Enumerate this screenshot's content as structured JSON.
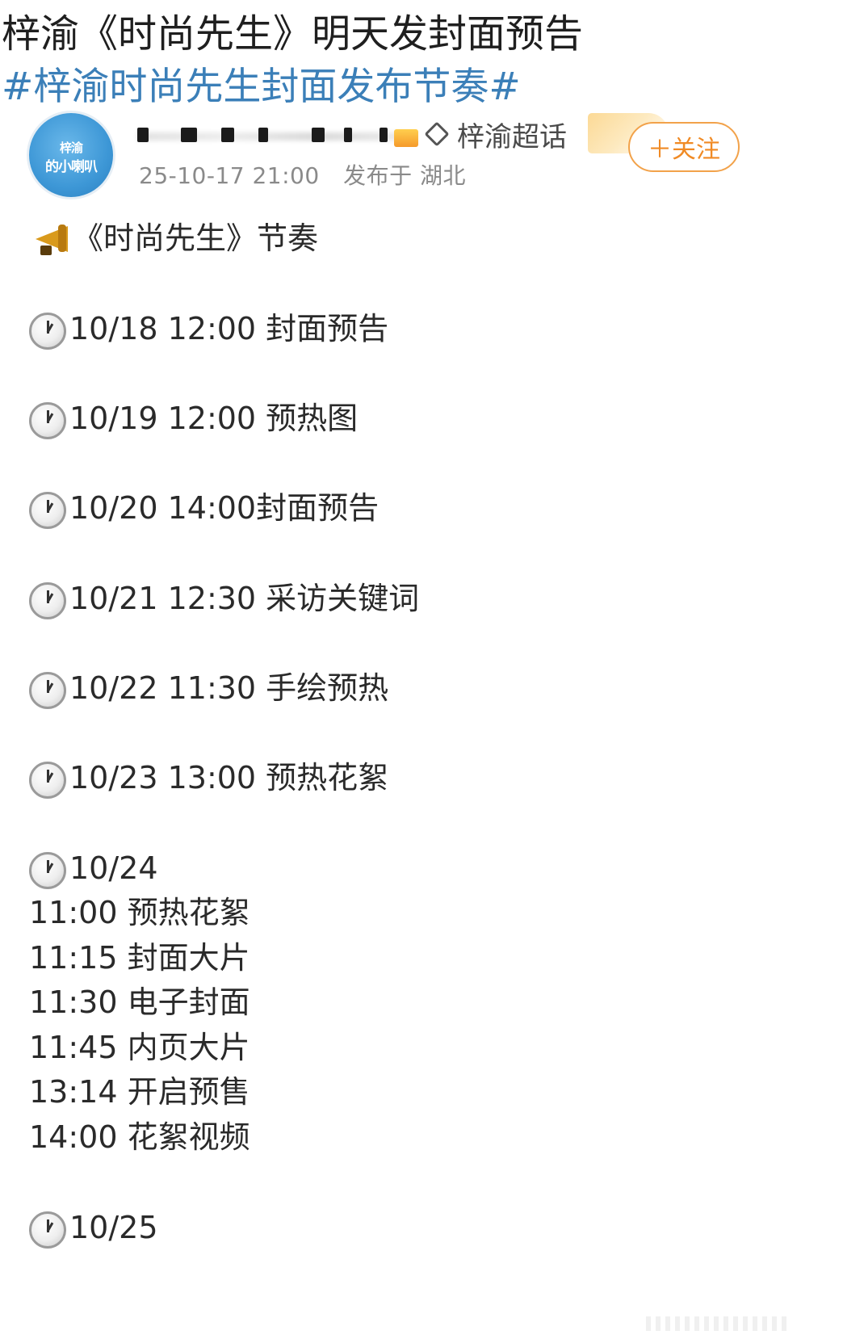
{
  "headline": "梓渝《时尚先生》明天发封面预告",
  "hashtag": "#梓渝时尚先生封面发布节奏#",
  "post": {
    "avatar_text_1": "梓渝",
    "avatar_text_2": "的小喇叭",
    "super_topic": "梓渝超话",
    "follow_label": "＋关注",
    "timestamp": "25-10-17 21:00",
    "location": "发布于 湖北"
  },
  "content": {
    "intro": "《时尚先生》节奏",
    "schedule": [
      "10/18 12:00 封面预告",
      "10/19 12:00 预热图",
      "10/20 14:00封面预告",
      "10/21 12:30 采访关键词",
      "10/22 11:30 手绘预热",
      "10/23 13:00 预热花絮"
    ],
    "day_1024": {
      "date": "10/24",
      "items": [
        "11:00 预热花絮",
        "11:15 封面大片",
        "11:30 电子封面",
        "11:45 内页大片",
        "13:14  开启预售",
        "14:00  花絮视频"
      ]
    },
    "day_1025": {
      "date": "10/25"
    }
  },
  "icons": {
    "intro": "megaphone-icon",
    "schedule": "clock-icon"
  },
  "colors": {
    "hashtag": "#3b7fb8",
    "follow": "#f08a24",
    "meta": "#8a8a8a"
  }
}
